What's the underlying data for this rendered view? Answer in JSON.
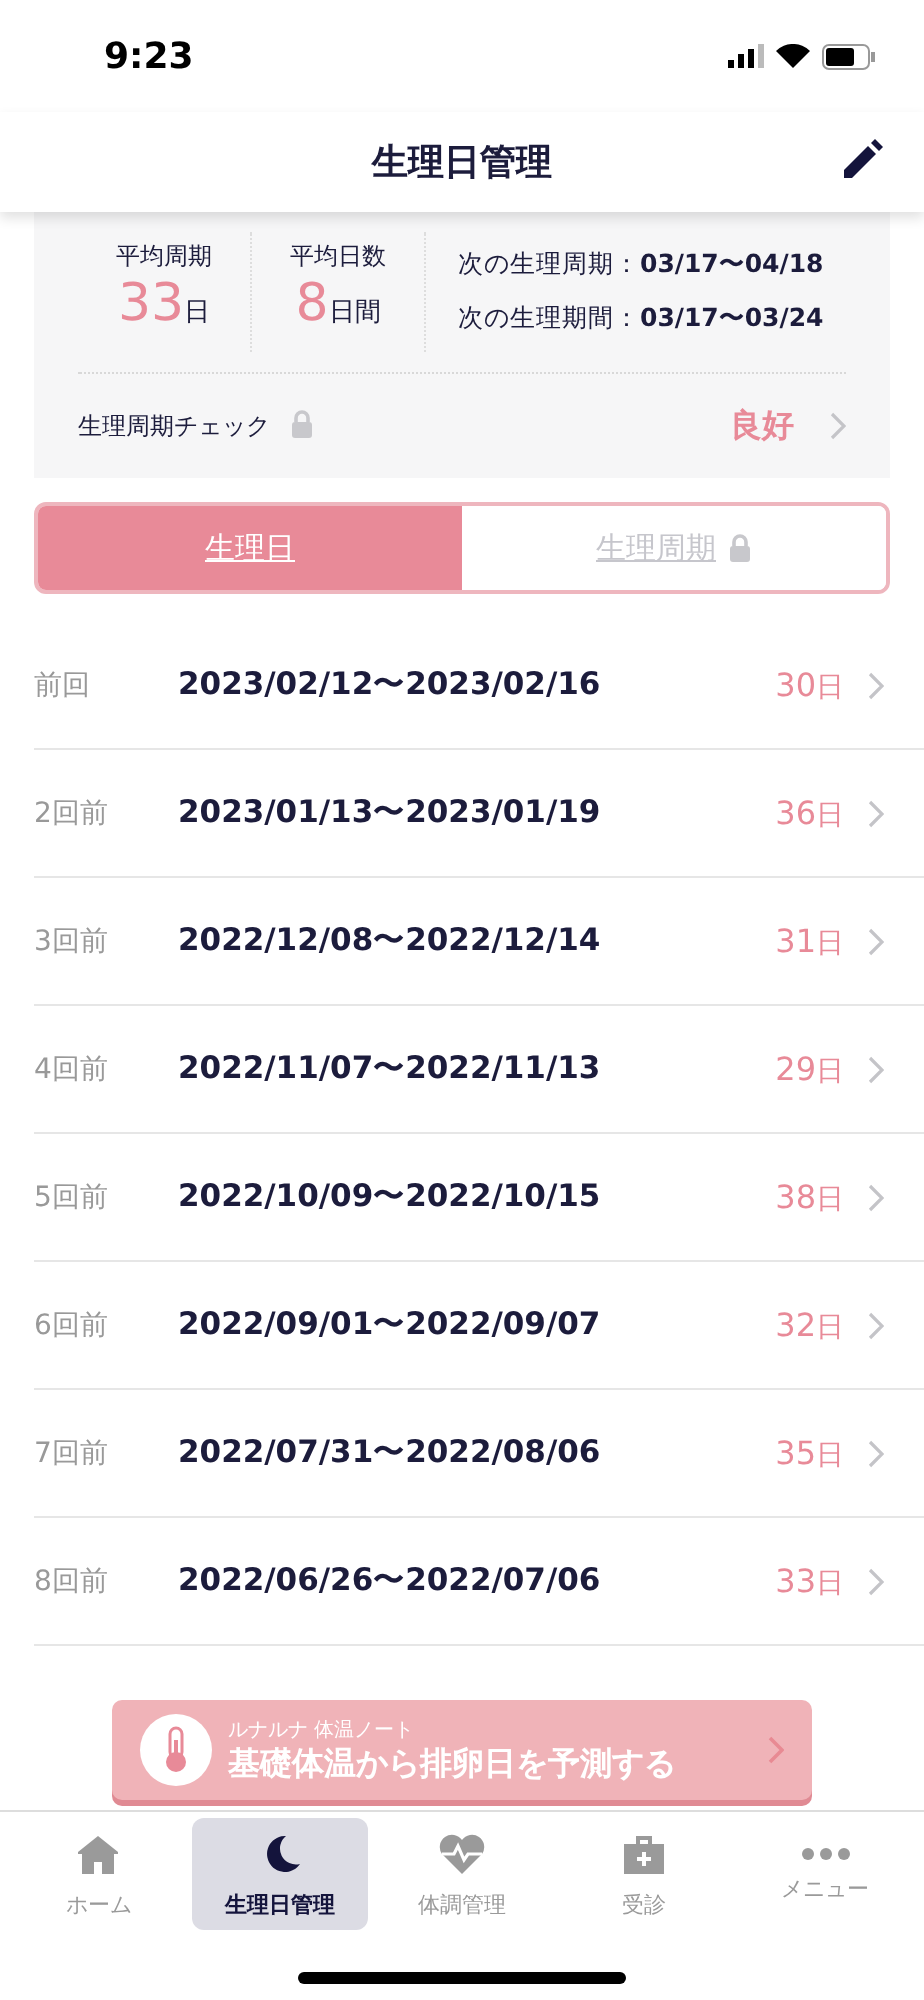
{
  "status_bar": {
    "time": "9:23"
  },
  "header": {
    "title": "生理日管理"
  },
  "summary": {
    "avg_cycle": {
      "label": "平均周期",
      "value": "33",
      "unit": "日"
    },
    "avg_days": {
      "label": "平均日数",
      "value": "8",
      "unit": "日間"
    },
    "next": [
      {
        "label": "次の生理周期：",
        "value": "03/17〜04/18"
      },
      {
        "label": "次の生理期間：",
        "value": "03/17〜03/24"
      }
    ],
    "check": {
      "label": "生理周期チェック",
      "locked": true,
      "result": "良好"
    }
  },
  "tabs": [
    {
      "label": "生理日",
      "selected": true,
      "locked": false
    },
    {
      "label": "生理周期",
      "selected": false,
      "locked": true
    }
  ],
  "rows": [
    {
      "label": "前回",
      "range": "2023/02/12〜2023/02/16",
      "days": "30",
      "unit": "日"
    },
    {
      "label": "2回前",
      "range": "2023/01/13〜2023/01/19",
      "days": "36",
      "unit": "日"
    },
    {
      "label": "3回前",
      "range": "2022/12/08〜2022/12/14",
      "days": "31",
      "unit": "日"
    },
    {
      "label": "4回前",
      "range": "2022/11/07〜2022/11/13",
      "days": "29",
      "unit": "日"
    },
    {
      "label": "5回前",
      "range": "2022/10/09〜2022/10/15",
      "days": "38",
      "unit": "日"
    },
    {
      "label": "6回前",
      "range": "2022/09/01〜2022/09/07",
      "days": "32",
      "unit": "日"
    },
    {
      "label": "7回前",
      "range": "2022/07/31〜2022/08/06",
      "days": "35",
      "unit": "日"
    },
    {
      "label": "8回前",
      "range": "2022/06/26〜2022/07/06",
      "days": "33",
      "unit": "日"
    }
  ],
  "banner": {
    "subtitle": "ルナルナ 体温ノート",
    "title": "基礎体温から排卵日を予測する"
  },
  "tab_bar": [
    {
      "label": "ホーム",
      "kind": "home",
      "selected": false
    },
    {
      "label": "生理日管理",
      "kind": "moon",
      "selected": true
    },
    {
      "label": "体調管理",
      "kind": "heart",
      "selected": false
    },
    {
      "label": "受診",
      "kind": "clinic",
      "selected": false
    },
    {
      "label": "メニュー",
      "kind": "more",
      "selected": false
    }
  ]
}
